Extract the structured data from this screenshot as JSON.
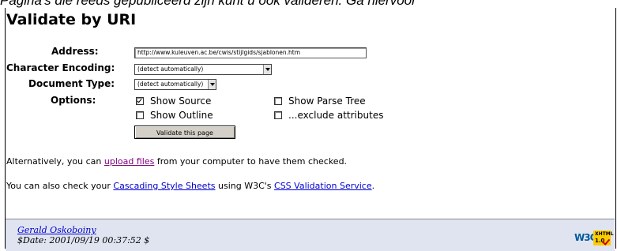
{
  "top_strip_text": "Pagina's die reeds gepubliceerd zijn kunt u ook valideren. Ga hiervoor",
  "page_title": "Validate by URI",
  "form": {
    "address_label": "Address:",
    "address_value": "http://www.kuleuven.ac.be/cwis/stijlgids/sjablonen.htm",
    "encoding_label": "Character Encoding:",
    "encoding_value": "(detect automatically)",
    "doctype_label": "Document Type:",
    "doctype_value": "(detect automatically)",
    "options_label": "Options:",
    "show_source_label": "Show Source",
    "show_source_checked": true,
    "show_parse_tree_label": "Show Parse Tree",
    "show_parse_tree_checked": false,
    "show_outline_label": "Show Outline",
    "show_outline_checked": false,
    "exclude_attributes_label": "...exclude attributes",
    "exclude_attributes_checked": false,
    "submit_label": "Validate this page"
  },
  "alt_line": {
    "prefix": "Alternatively, you can ",
    "link": "upload files",
    "suffix": " from your computer to have them checked."
  },
  "css_line": {
    "prefix": "You can also check your ",
    "link1": "Cascading Style Sheets",
    "middle": " using W3C's ",
    "link2": "CSS Validation Service",
    "suffix": "."
  },
  "footer": {
    "author": "Gerald Oskoboiny",
    "date": "$Date: 2001/09/19 00:37:52 $",
    "w3c_logo": "W3C",
    "badge_line1": "XHTML",
    "badge_line2": "1.0"
  },
  "colors": {
    "link_visited": "#800080",
    "link_unvisited": "#0000cc",
    "footer_bg": "#dfe4f0",
    "badge_bg": "#ffcc00"
  }
}
